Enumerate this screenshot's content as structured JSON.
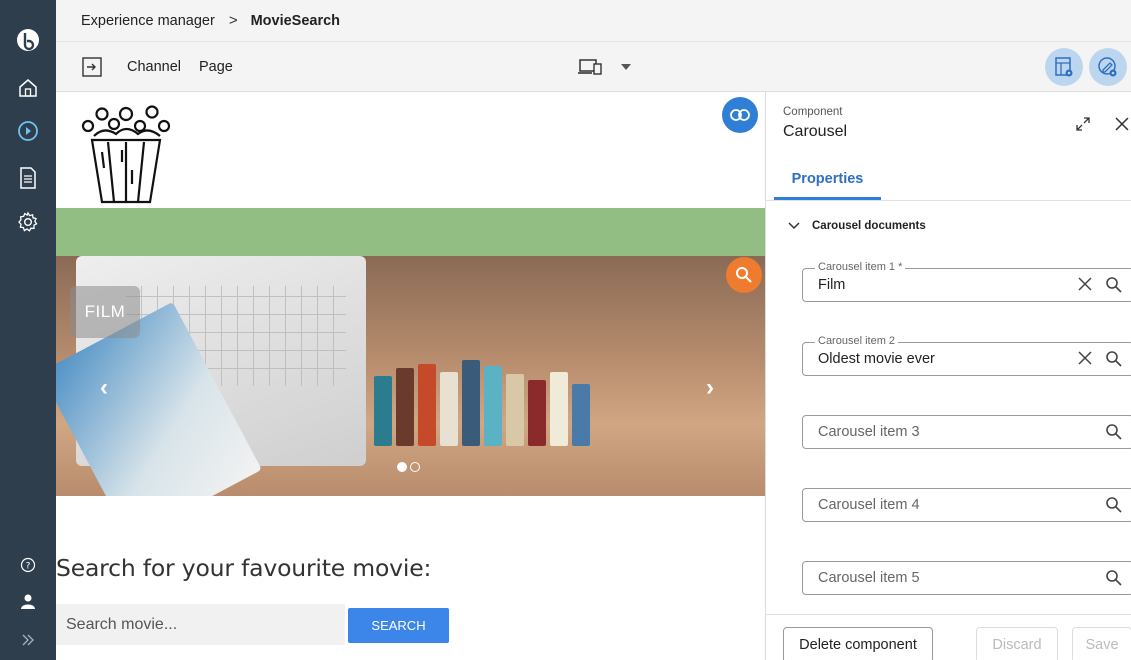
{
  "nav": {
    "items": [
      {
        "name": "logo",
        "icon": "app-logo-icon"
      },
      {
        "name": "home",
        "icon": "home-icon"
      },
      {
        "name": "experience-manager",
        "icon": "play-circle-icon",
        "active": true
      },
      {
        "name": "content",
        "icon": "document-icon"
      },
      {
        "name": "settings",
        "icon": "gear-icon"
      },
      {
        "name": "help",
        "icon": "help-icon"
      },
      {
        "name": "user",
        "icon": "user-icon"
      },
      {
        "name": "expand",
        "icon": "double-chevron-right-icon"
      }
    ],
    "active_color": "#6ec3f0"
  },
  "breadcrumb": {
    "root": "Experience manager",
    "separator": ">",
    "current": "MovieSearch"
  },
  "toolbar": {
    "channel_label": "Channel",
    "page_label": "Page",
    "icons": [
      "exit-panel-icon",
      "device-preview-icon",
      "caret-down-icon",
      "page-preview-icon",
      "edit-preview-icon"
    ]
  },
  "preview": {
    "logo": "popcorn-icon",
    "band_color": "#92bd83",
    "carousel": {
      "caption": "FILM",
      "slide_count": 2,
      "active_slide": 1
    },
    "heading": "Search for your favourite movie:",
    "search_placeholder": "Search movie...",
    "search_button": "SEARCH",
    "accent_blue": "#2f7fd6",
    "accent_orange": "#ef7b2f"
  },
  "panel": {
    "subtitle": "Component",
    "title": "Carousel",
    "tab": "Properties",
    "section": "Carousel documents",
    "fields": [
      {
        "label": "Carousel item 1 *",
        "value": "Film",
        "placeholder": ""
      },
      {
        "label": "Carousel item 2",
        "value": "Oldest movie ever",
        "placeholder": ""
      },
      {
        "label": "",
        "value": "",
        "placeholder": "Carousel item 3"
      },
      {
        "label": "",
        "value": "",
        "placeholder": "Carousel item 4"
      },
      {
        "label": "",
        "value": "",
        "placeholder": "Carousel item 5"
      }
    ],
    "delete_label": "Delete component",
    "discard_label": "Discard",
    "save_label": "Save"
  }
}
